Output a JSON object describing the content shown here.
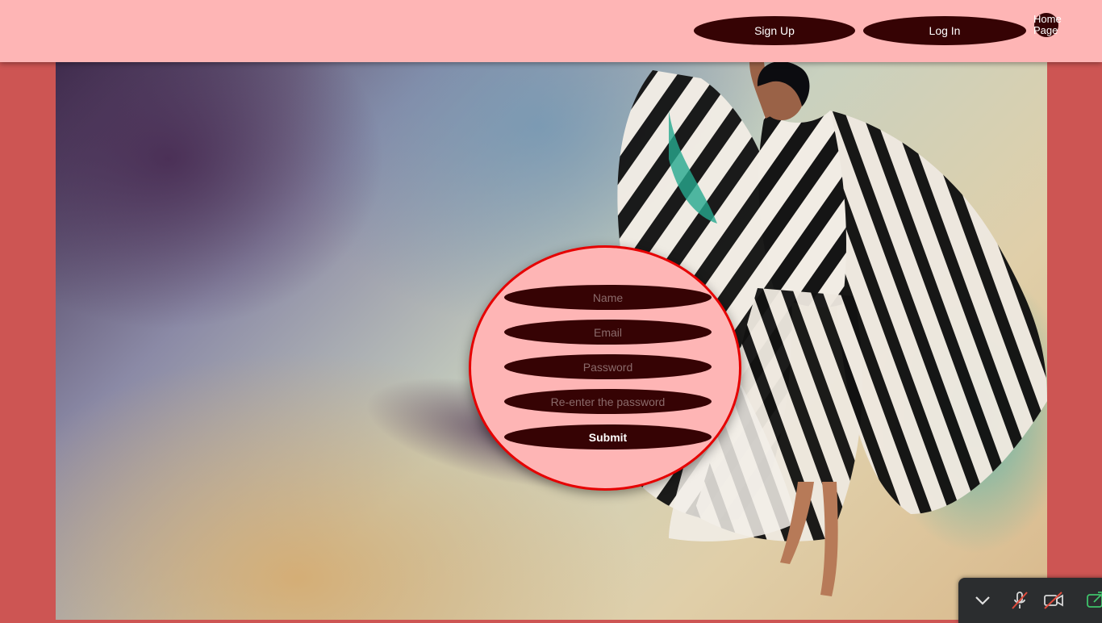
{
  "header": {
    "nav": {
      "signup_label": "Sign Up",
      "login_label": "Log In",
      "home_label_line1": "Home",
      "home_label_line2": "Page"
    }
  },
  "form": {
    "name_placeholder": "Name",
    "email_placeholder": "Email",
    "password_placeholder": "Password",
    "repassword_placeholder": "Re-enter the password",
    "submit_label": "Submit"
  },
  "meeting_bar": {
    "icons": [
      "chevron-down-icon",
      "mic-muted-icon",
      "camera-off-icon",
      "share-screen-icon"
    ]
  },
  "colors": {
    "header_bg": "#feb5b5",
    "page_bg": "#cd5553",
    "button_bg": "#360304",
    "form_border": "#e60000"
  }
}
